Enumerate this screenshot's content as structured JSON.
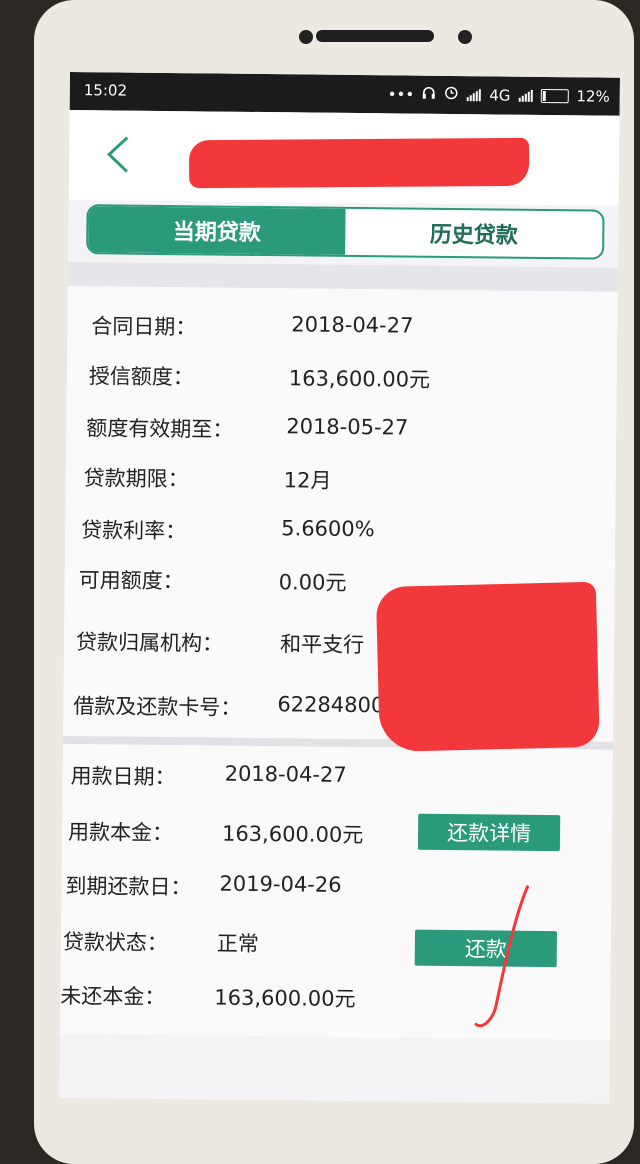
{
  "status": {
    "time": "15:02",
    "dots": "•••",
    "network": "4G",
    "battery": "12%"
  },
  "tabs": [
    {
      "label": "当期贷款"
    },
    {
      "label": "历史贷款"
    }
  ],
  "contract": [
    {
      "label": "合同日期：",
      "value": "2018-04-27"
    },
    {
      "label": "授信额度：",
      "value": "163,600.00元"
    },
    {
      "label": "额度有效期至：",
      "value": "2018-05-27"
    },
    {
      "label": "贷款期限：",
      "value": "12月"
    },
    {
      "label": "贷款利率：",
      "value": "5.6600%"
    },
    {
      "label": "可用额度：",
      "value": "0.00元"
    },
    {
      "label": "贷款归属机构：",
      "value": "和平支行"
    },
    {
      "label": "借款及还款卡号：",
      "value": "62284800"
    }
  ],
  "loan": [
    {
      "label": "用款日期：",
      "value": "2018-04-27"
    },
    {
      "label": "用款本金：",
      "value": "163,600.00元"
    },
    {
      "label": "到期还款日：",
      "value": "2019-04-26"
    },
    {
      "label": "贷款状态：",
      "value": "正常"
    },
    {
      "label": "未还本金：",
      "value": "163,600.00元"
    }
  ],
  "buttons": {
    "repay_detail": "还款详情",
    "repay": "还款"
  },
  "colors": {
    "accent": "#2a9a7a",
    "redaction": "#f2383a"
  }
}
